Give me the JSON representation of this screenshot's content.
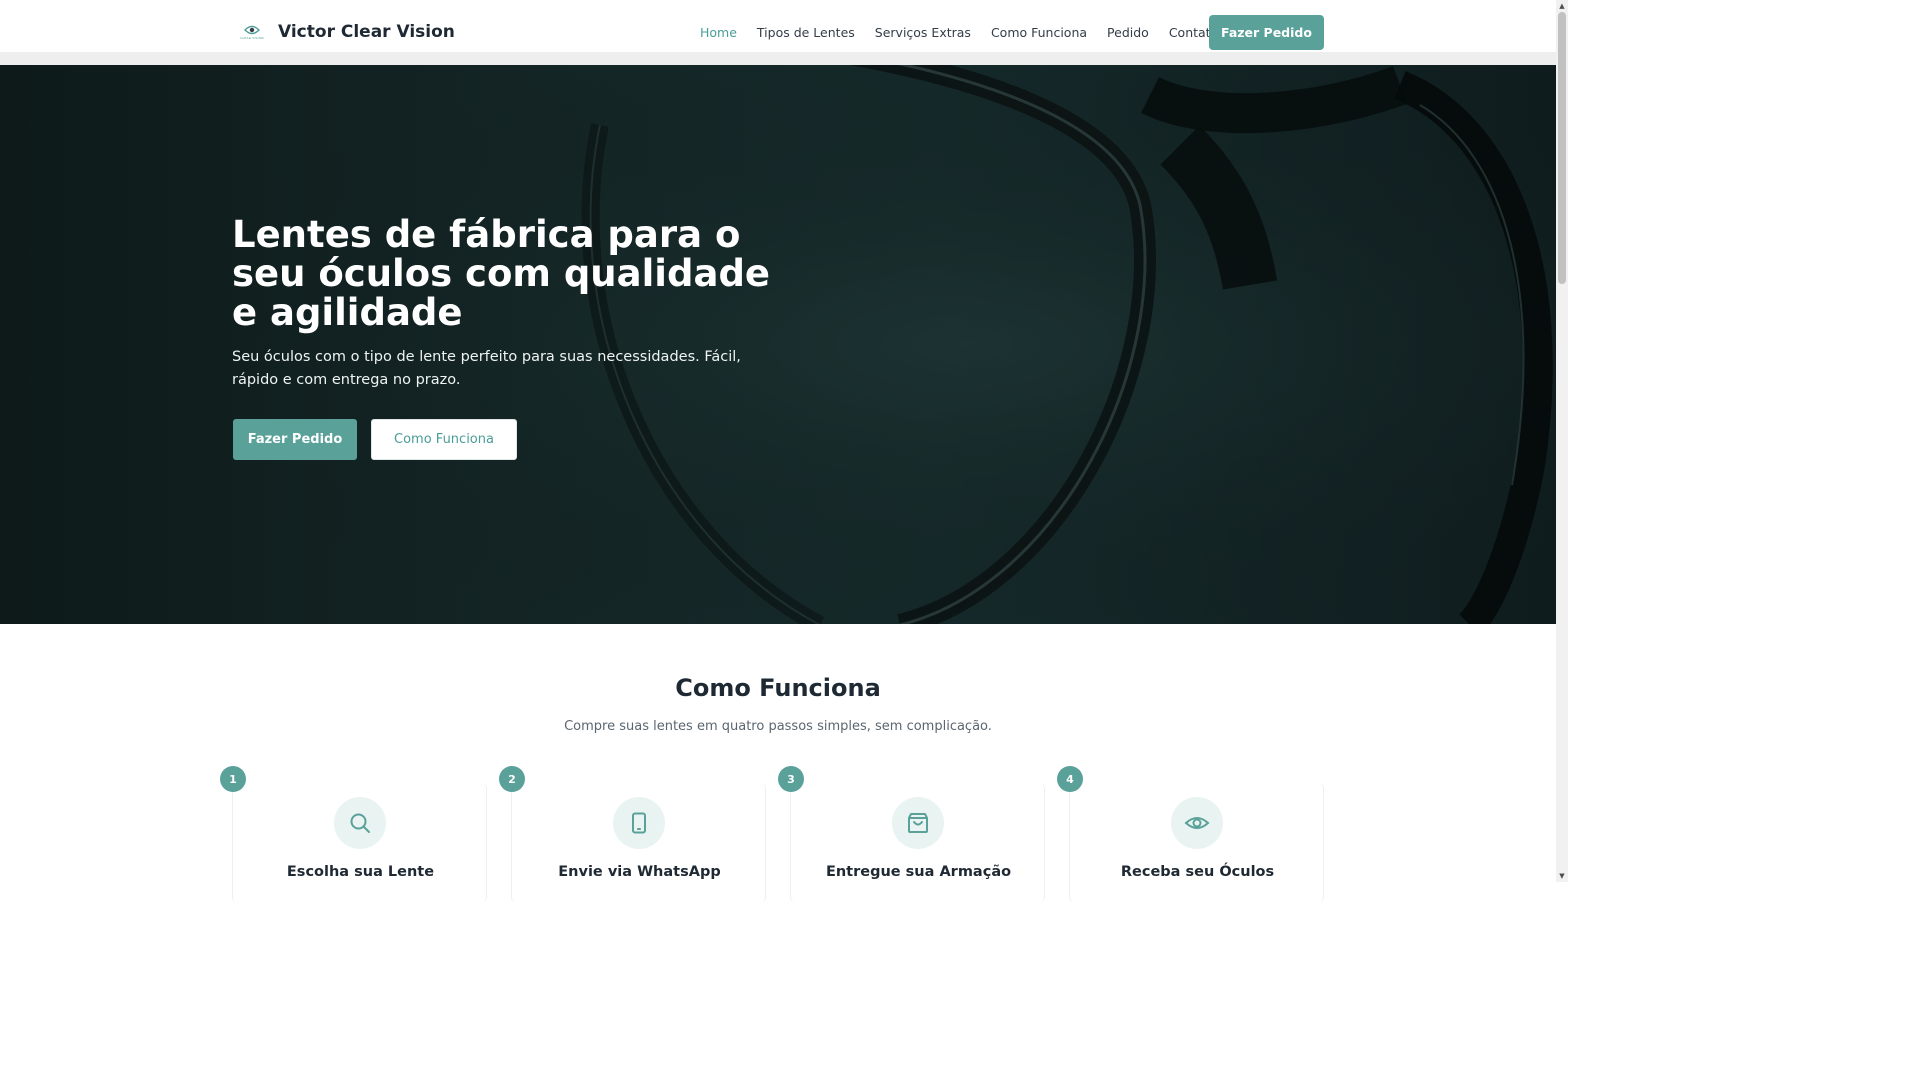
{
  "header": {
    "brand_name": "Victor Clear Vision",
    "logo_text": "CLEAR VISION",
    "logo_icon": "eye-icon",
    "nav": [
      {
        "label": "Home",
        "active": true
      },
      {
        "label": "Tipos de Lentes",
        "active": false
      },
      {
        "label": "Serviços Extras",
        "active": false
      },
      {
        "label": "Como Funciona",
        "active": false
      },
      {
        "label": "Pedido",
        "active": false
      },
      {
        "label": "Contato",
        "active": false
      }
    ],
    "cta_label": "Fazer Pedido"
  },
  "hero": {
    "title": "Lentes de fábrica para o seu óculos com qualidade e agilidade",
    "subtitle": "Seu óculos com o tipo de lente perfeito para suas necessidades. Fácil, rápido e com entrega no prazo.",
    "primary_button": "Fazer Pedido",
    "secondary_button": "Como Funciona"
  },
  "how_it_works": {
    "title": "Como Funciona",
    "subtitle": "Compre suas lentes em quatro passos simples, sem complicação.",
    "steps": [
      {
        "number": "1",
        "title": "Escolha sua Lente",
        "icon": "search-icon"
      },
      {
        "number": "2",
        "title": "Envie via WhatsApp",
        "icon": "smartphone-icon"
      },
      {
        "number": "3",
        "title": "Entregue sua Armação",
        "icon": "shopping-bag-icon"
      },
      {
        "number": "4",
        "title": "Receba seu Óculos",
        "icon": "eye-icon"
      }
    ]
  },
  "colors": {
    "accent": "#5aa19a",
    "accent_text": "#4a9e97",
    "hero_bg": "#142525",
    "icon_bg": "#e9f3f2"
  }
}
